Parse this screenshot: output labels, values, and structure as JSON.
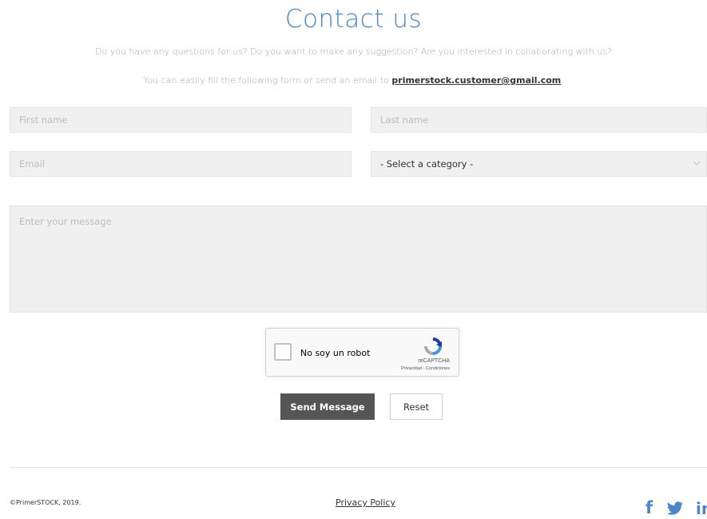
{
  "header": {
    "title": "Contact us",
    "intro_line1": "Do you have any questions for us? Do you want to make any suggestion? Are you interested in collaborating with us?",
    "intro_line2_prefix": "You can easily fill the following form or send an email to ",
    "email_link": "primerstock.customer@gmail.com",
    "intro_line2_suffix": "."
  },
  "form": {
    "first_name_placeholder": "First name",
    "last_name_placeholder": "Last name",
    "email_placeholder": "Email",
    "category_selected": "- Select a category -",
    "message_placeholder": "Enter your message",
    "send_label": "Send Message",
    "reset_label": "Reset"
  },
  "captcha": {
    "label": "No soy un robot",
    "brand": "reCAPTCHA",
    "terms": "Privacidad - Condiciones"
  },
  "footer": {
    "copyright": "©PrimerSTOCK, 2019.",
    "privacy_label": "Privacy Policy",
    "social": [
      {
        "icon": "facebook-icon",
        "glyph": "f"
      },
      {
        "icon": "twitter-icon",
        "glyph": ""
      },
      {
        "icon": "linkedin-icon",
        "glyph": "in"
      }
    ]
  },
  "colors": {
    "accent": "#4a86c5",
    "button_dark": "#555555",
    "field_bg": "#f0f0f0"
  }
}
